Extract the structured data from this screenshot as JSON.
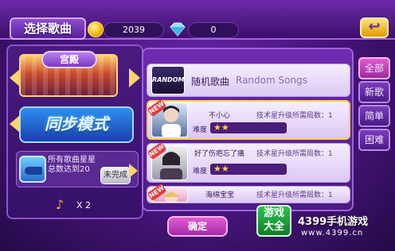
{
  "header": {
    "title": "选择歌曲",
    "coins": "2039",
    "gems": "0",
    "back_icon": "back-arrow-icon"
  },
  "left_panel": {
    "scene_label": "宫殿",
    "mode_label": "同步模式",
    "task_text_line1": "所有歌曲星星",
    "task_text_line2": "总数达到20",
    "task_button": "未完成",
    "note_count": "X 2"
  },
  "song_list": {
    "random": {
      "logo_text": "RANDOM",
      "title_cn": "随机歌曲",
      "title_en": "Random Songs"
    },
    "songs": [
      {
        "new_tag": "NEW",
        "name": "不小心",
        "requirement": "技术星升级所需局数：1",
        "difficulty_label": "难度",
        "stars": "★★",
        "selected": true
      },
      {
        "new_tag": "NEW",
        "name": "好了伤疤忘了痛",
        "requirement": "技术星升级所需局数：1",
        "difficulty_label": "难度",
        "stars": "★★",
        "selected": false
      },
      {
        "new_tag": "NEW",
        "name": "海绵宝宝",
        "requirement": "技术星升级所需局数：1",
        "difficulty_label": "",
        "stars": "",
        "selected": false
      }
    ]
  },
  "tabs": [
    {
      "label": "全部",
      "active": true
    },
    {
      "label": "新歌",
      "active": false
    },
    {
      "label": "简单",
      "active": false
    },
    {
      "label": "困难",
      "active": false
    }
  ],
  "footer": {
    "confirm_label": "确定"
  },
  "watermark": {
    "badge_line1": "游戏",
    "badge_line2": "大全",
    "brand": "4399手机游戏",
    "url": "www.4399.cn"
  },
  "colors": {
    "accent": "#ffd23a",
    "panel": "#4b1a86",
    "tab_active": "#e35bd0"
  }
}
